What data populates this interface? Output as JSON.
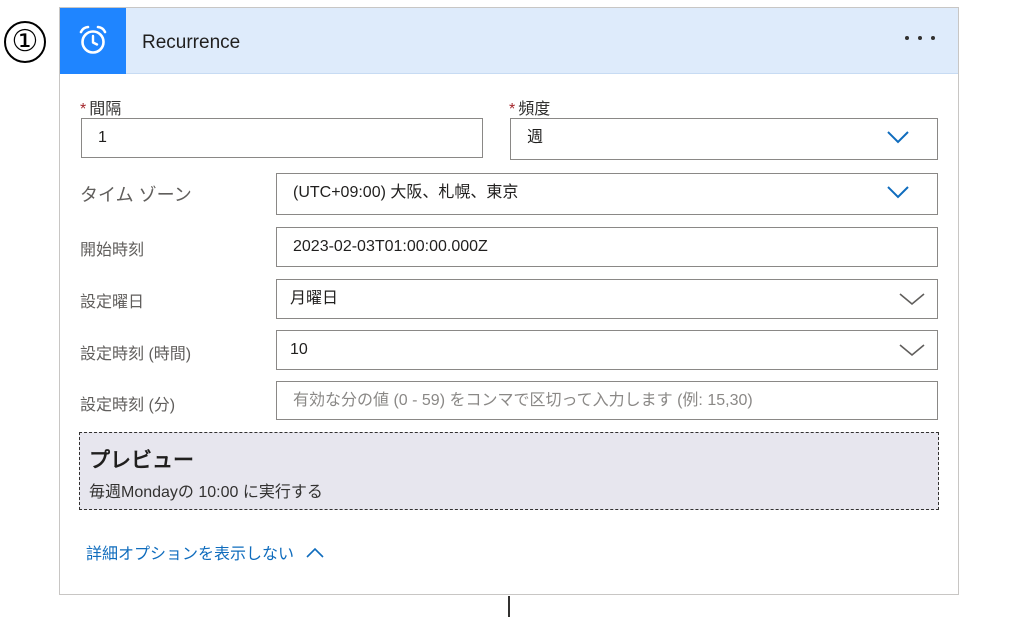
{
  "step_marker": "①",
  "header": {
    "title": "Recurrence",
    "icon": "alarm-clock-icon",
    "more_icon": "more-options-icon",
    "accent_color": "#1f85ff",
    "header_bg": "#deebfb"
  },
  "fields": {
    "interval": {
      "required_mark": "*",
      "label": "間隔",
      "value": "1"
    },
    "frequency": {
      "required_mark": "*",
      "label": "頻度",
      "value": "週"
    },
    "timezone": {
      "label": "タイム ゾーン",
      "value": "(UTC+09:00) 大阪、札幌、東京"
    },
    "start_time": {
      "label": "開始時刻",
      "value": "2023-02-03T01:00:00.000Z"
    },
    "weekdays": {
      "label": "設定曜日",
      "value": "月曜日"
    },
    "hours": {
      "label": "設定時刻 (時間)",
      "value": "10"
    },
    "minutes": {
      "label": "設定時刻 (分)",
      "value": "",
      "placeholder": "有効な分の値 (0 - 59) をコンマで区切って入力します (例: 15,30)"
    }
  },
  "preview": {
    "title": "プレビュー",
    "text": "毎週Mondayの 10:00 に実行する"
  },
  "advanced_toggle": {
    "label": "詳細オプションを表示しない"
  }
}
